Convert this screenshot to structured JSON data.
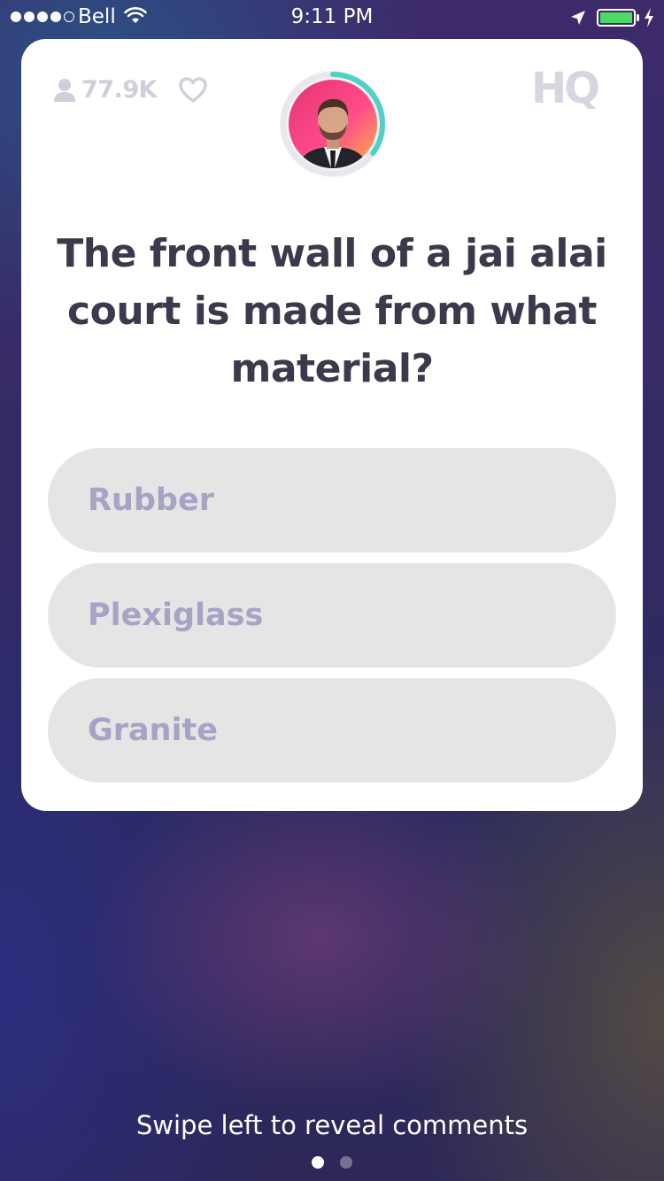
{
  "status_bar": {
    "carrier": "Bell",
    "time": "9:11 PM",
    "battery_level": 1.0,
    "signal_bars": 4,
    "signal_total": 5
  },
  "header": {
    "viewer_count": "77.9K",
    "logo": "HQ",
    "timer_progress": 0.35,
    "icons": [
      "person-icon",
      "heart-icon"
    ]
  },
  "question": {
    "text": "The front wall of a jai alai court is made from what material?"
  },
  "answers": [
    {
      "label": "Rubber"
    },
    {
      "label": "Plexiglass"
    },
    {
      "label": "Granite"
    }
  ],
  "footer": {
    "hint": "Swipe left to reveal comments",
    "page_index": 0,
    "page_count": 2
  },
  "colors": {
    "accent_timer": "#4fd1c5",
    "answer_bg": "#e5e5e5",
    "answer_text": "#a6a4c4",
    "question_text": "#3a3a4c"
  }
}
